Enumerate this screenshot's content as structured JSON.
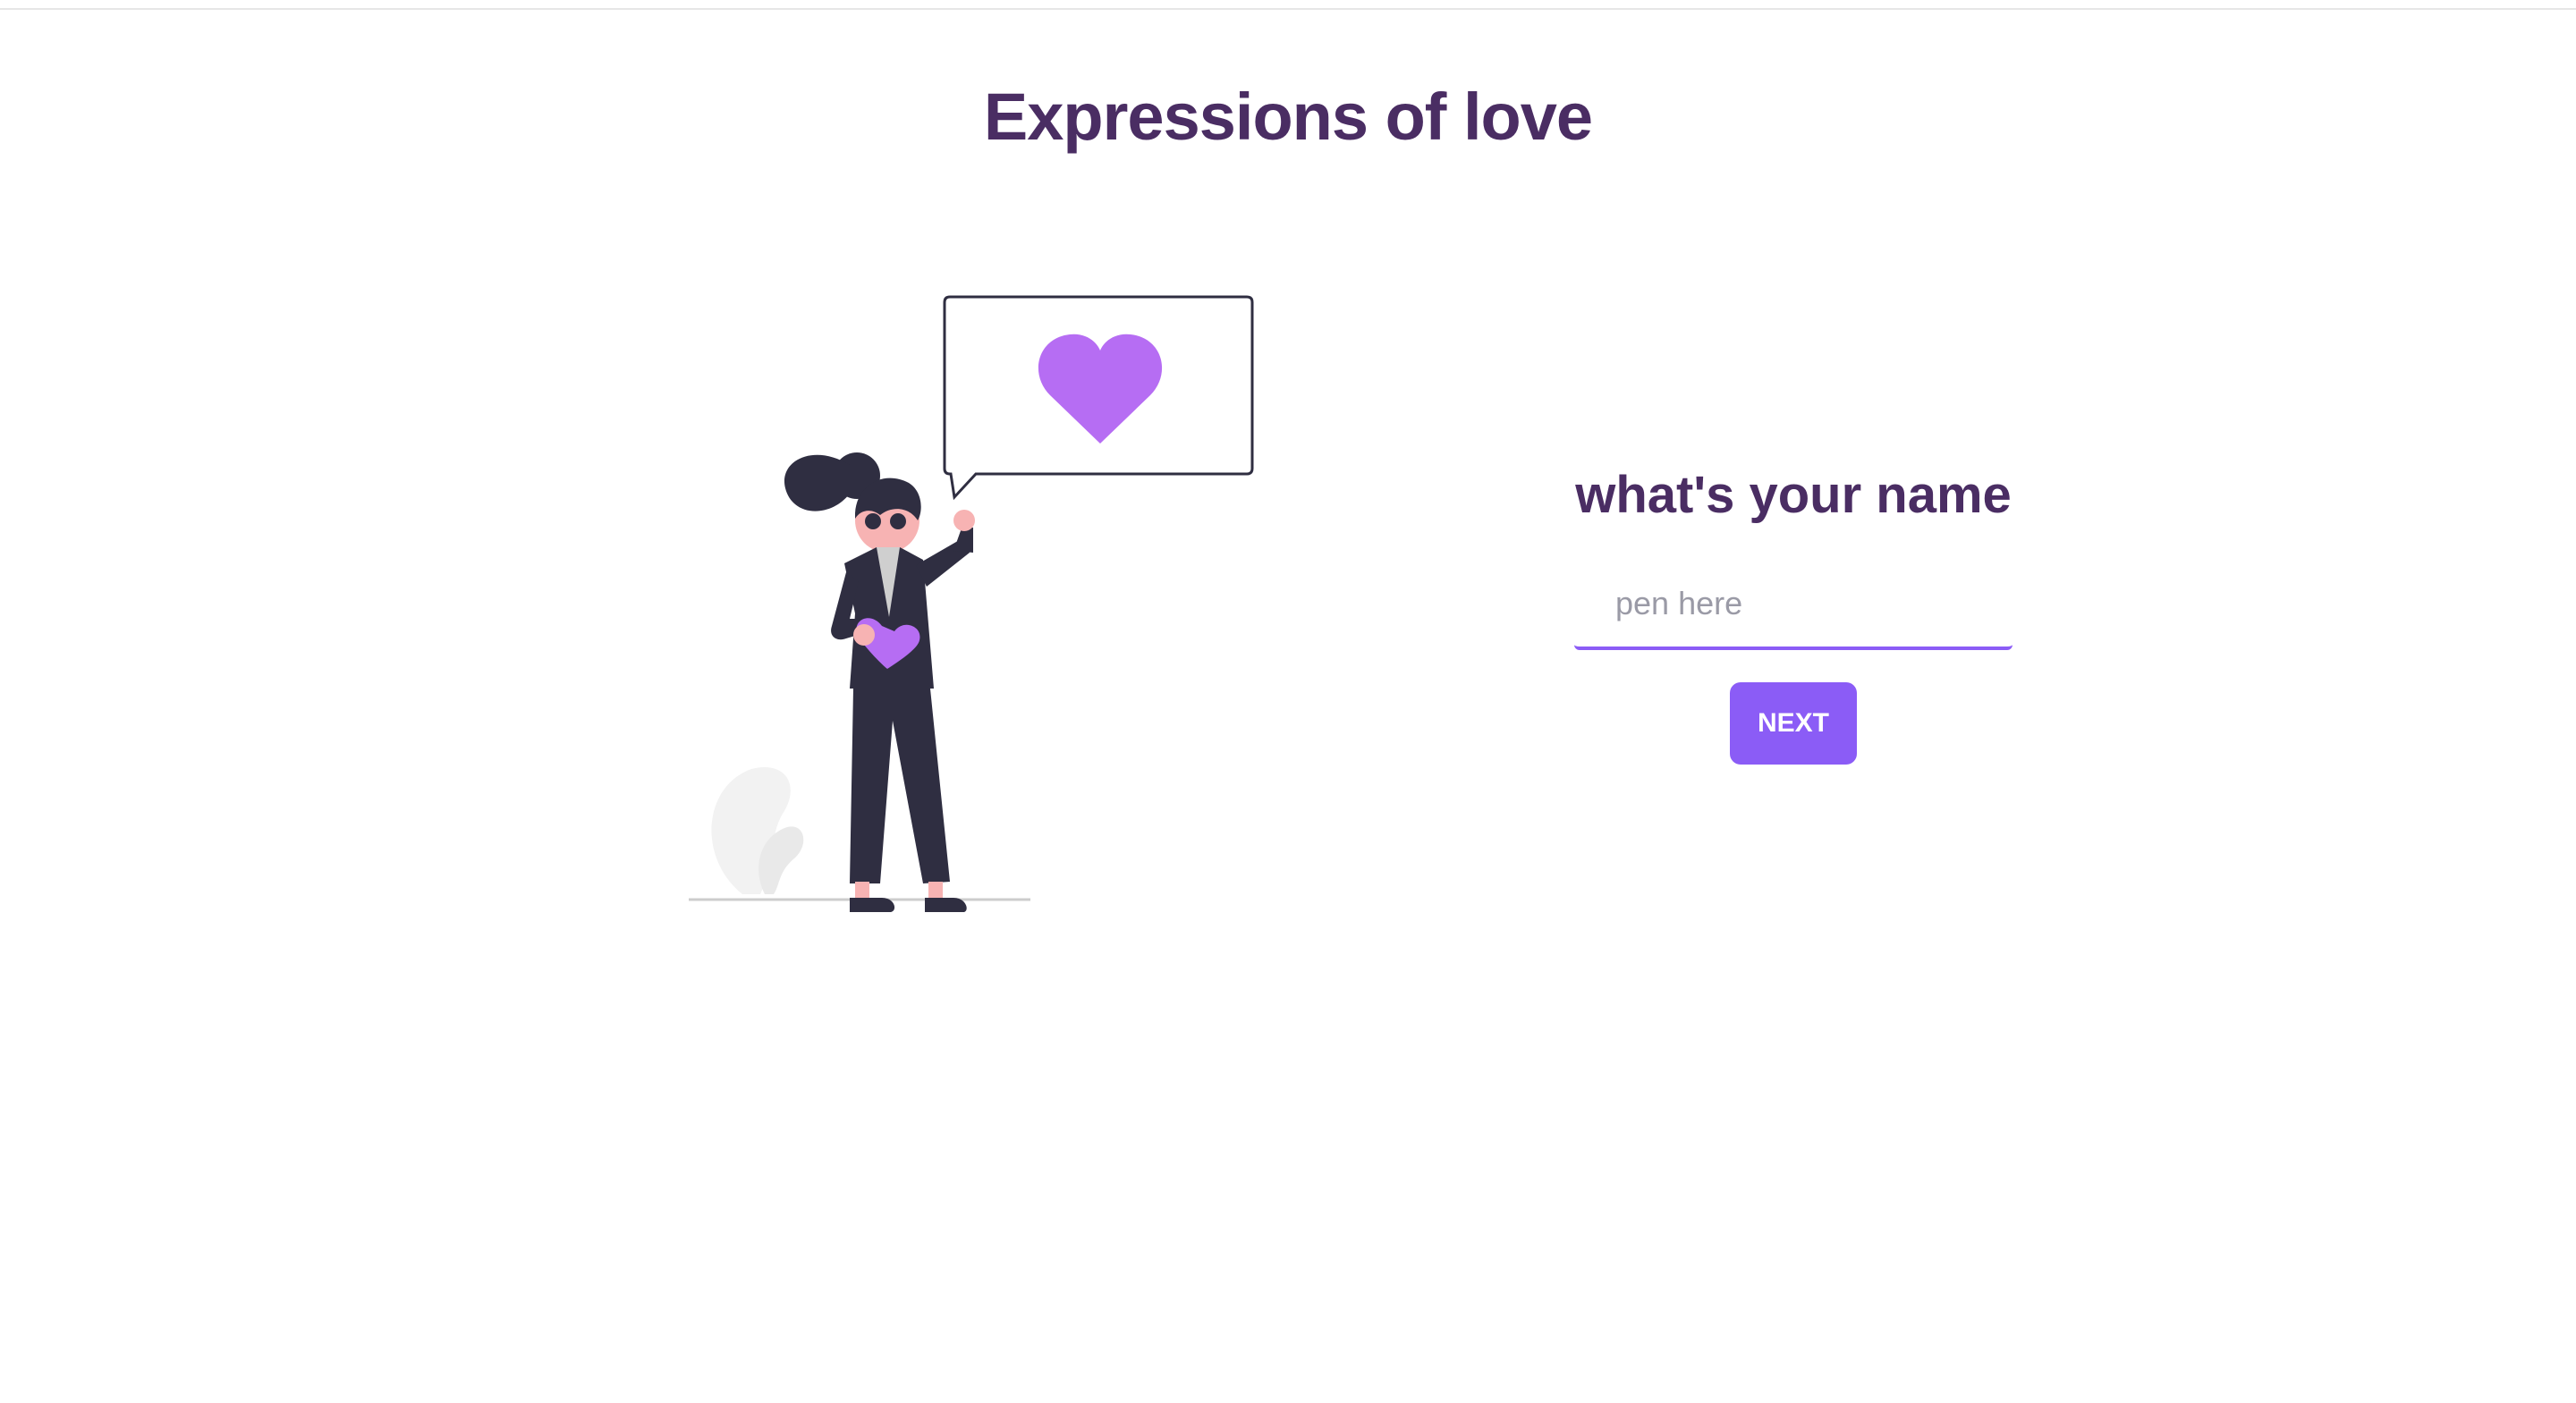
{
  "page": {
    "title": "Expressions of love"
  },
  "form": {
    "heading": "what's your name",
    "name_input": {
      "value": "",
      "placeholder": "pen here"
    },
    "next_label": "NEXT"
  },
  "illustration": {
    "icon": "heart-icon",
    "description_name": "woman-with-heart-illustration"
  },
  "colors": {
    "title": "#4a2d63",
    "accent": "#8b5cf6",
    "heart": "#b66df3",
    "figure_dark": "#2f2e41",
    "skin": "#f7b3b3",
    "plant": "#f2f2f2"
  }
}
